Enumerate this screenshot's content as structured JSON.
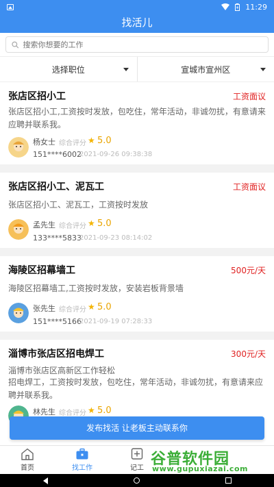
{
  "status_bar": {
    "time": "11:29"
  },
  "app_bar": {
    "title": "找活儿"
  },
  "search": {
    "placeholder": "搜索你想要的工作"
  },
  "filters": {
    "position": "选择职位",
    "location": "宣城市宣州区"
  },
  "jobs": [
    {
      "title": "张店区招小工",
      "salary": "工资面议",
      "desc": "张店区招小工,工资按时发放，包吃住，常年活动，非诚勿扰，有意请来应聘并联系我。",
      "name": "杨女士",
      "rating_label": "综合评分",
      "score": "5.0",
      "phone": "151****6002",
      "time": "2021-09-26 09:38:38"
    },
    {
      "title": "张店区招小工、泥瓦工",
      "salary": "工资面议",
      "desc": "张店区招小工、泥瓦工，工资按时发放",
      "name": "孟先生",
      "rating_label": "综合评分",
      "score": "5.0",
      "phone": "133****5833",
      "time": "2021-09-23 08:14:02"
    },
    {
      "title": "海陵区招幕墙工",
      "salary": "500元/天",
      "desc": "海陵区招幕墙工,工资按时发放，安装岩板背景墙",
      "name": "张先生",
      "rating_label": "综合评分",
      "score": "5.0",
      "phone": "151****5166",
      "time": "2021-09-19 07:28:33"
    },
    {
      "title": "淄博市张店区招电焊工",
      "salary": "300元/天",
      "desc_line1": "淄博市张店区高新区工作轻松",
      "desc_line2": "招电焊工，工资按时发放，包吃住，常年活动，非诚勿扰，有意请来应聘并联系我。",
      "name": "林先生",
      "rating_label": "综合评分",
      "score": "5.0"
    }
  ],
  "publish_button": {
    "label": "发布找活 让老板主动联系你"
  },
  "tabs": [
    {
      "label": "首页",
      "icon": "home-icon"
    },
    {
      "label": "找工作",
      "icon": "briefcase-icon"
    },
    {
      "label": "记工",
      "icon": "plus-square-icon"
    }
  ],
  "watermark": {
    "title": "谷普软件园",
    "url": "www.gupuxiazai.com"
  },
  "colors": {
    "primary": "#3d8ef0",
    "salary": "#e02020",
    "star": "#f4b400",
    "watermark": "#3cae38"
  }
}
